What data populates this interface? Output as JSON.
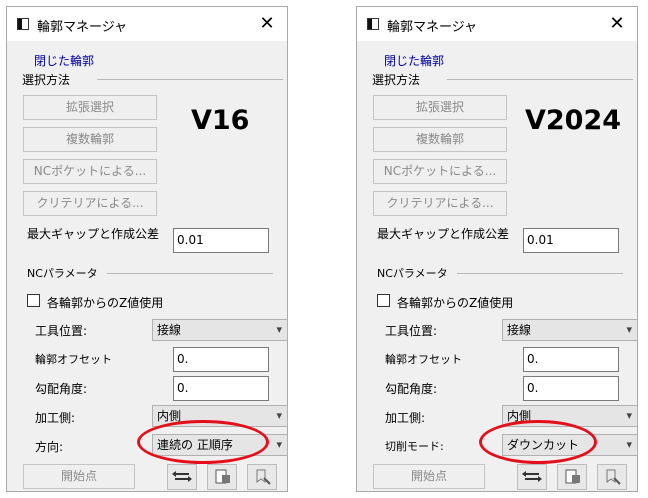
{
  "panels": [
    {
      "title": "輪郭マネージャ",
      "close_glyph": "✕",
      "sub_header": "閉じた輪郭",
      "selection_label": "選択方法",
      "buttons": [
        "拡張選択",
        "複数輪郭",
        "NCポケットによる...",
        "クリテリアによる..."
      ],
      "version": "V16",
      "gap_label": "最大ギャップと作成公差",
      "gap_value": "0.01",
      "nc_params_label": "NCパラメータ",
      "z_checkbox_label": "各輪郭からのZ値使用",
      "z_checked": false,
      "tool_pos_label": "工具位置:",
      "tool_pos_value": "接線",
      "offset_label": "輪郭オフセット",
      "offset_value": "0.",
      "angle_label": "勾配角度:",
      "angle_value": "0.",
      "side_label": "加工側:",
      "side_value": "内側",
      "last_label": "方向:",
      "last_value": "連続の 正順序",
      "start_label": "開始点",
      "highlight_color": "#e3101b"
    },
    {
      "title": "輪郭マネージャ",
      "close_glyph": "✕",
      "sub_header": "閉じた輪郭",
      "selection_label": "選択方法",
      "buttons": [
        "拡張選択",
        "複数輪郭",
        "NCポケットによる...",
        "クリテリアによる..."
      ],
      "version": "V2024",
      "gap_label": "最大ギャップと作成公差",
      "gap_value": "0.01",
      "nc_params_label": "NCパラメータ",
      "z_checkbox_label": "各輪郭からのZ値使用",
      "z_checked": false,
      "tool_pos_label": "工具位置:",
      "tool_pos_value": "接線",
      "offset_label": "輪郭オフセット",
      "offset_value": "0.",
      "angle_label": "勾配角度:",
      "angle_value": "0.",
      "side_label": "加工側:",
      "side_value": "内側",
      "last_label": "切削モード:",
      "last_value": "ダウンカット",
      "start_label": "開始点",
      "highlight_color": "#e3101b"
    }
  ]
}
